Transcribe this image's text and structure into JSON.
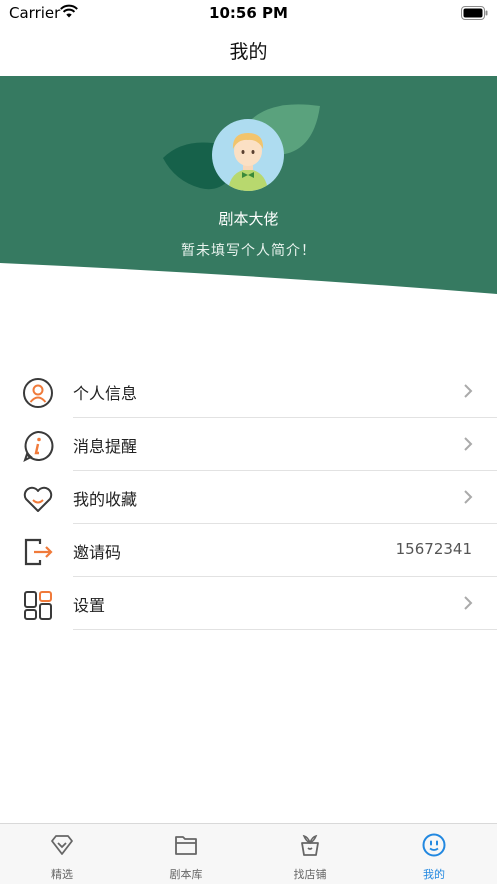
{
  "status_bar": {
    "carrier": "Carrier",
    "time": "10:56 PM"
  },
  "nav": {
    "title": "我的"
  },
  "profile": {
    "name": "剧本大佬",
    "bio": "暂未填写个人简介！"
  },
  "menu": [
    {
      "label": "个人信息",
      "icon": "user-circle-icon"
    },
    {
      "label": "消息提醒",
      "icon": "info-bubble-icon"
    },
    {
      "label": "我的收藏",
      "icon": "heart-icon"
    },
    {
      "label": "邀请码",
      "icon": "exit-arrow-icon",
      "value": "15672341"
    },
    {
      "label": "设置",
      "icon": "grid-settings-icon"
    }
  ],
  "tabs": [
    {
      "label": "精选",
      "icon": "diamond-icon",
      "active": false
    },
    {
      "label": "剧本库",
      "icon": "folder-icon",
      "active": false
    },
    {
      "label": "找店铺",
      "icon": "store-icon",
      "active": false
    },
    {
      "label": "我的",
      "icon": "smiley-icon",
      "active": true
    }
  ],
  "colors": {
    "header_green": "#367a61",
    "accent_orange": "#f07a3a",
    "tab_active": "#2288e0"
  }
}
